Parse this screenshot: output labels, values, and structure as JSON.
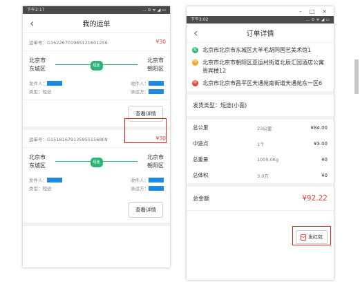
{
  "left": {
    "status_time": "下午2:17",
    "status_icons": "... ⊙ ᯤ ◢ ▭",
    "title": "我的运单",
    "cards": [
      {
        "waybill": "运单号：G15226701985121601256",
        "price": "¥30",
        "from_city": "北京市",
        "from_district": "东城区",
        "tag": "短途",
        "to_city": "北京市",
        "to_district": "朝阳区",
        "sender_label": "发件人：",
        "type_label": "类型：短途",
        "receiver_label": "收件人：",
        "carrier_label": "承运方：",
        "detail_button": "查看详情"
      },
      {
        "waybill": "运单号：G15181679135955156809",
        "price": "¥30",
        "from_city": "北京市",
        "from_district": "东城区",
        "tag": "短途",
        "to_city": "北京市",
        "to_district": "朝阳区",
        "sender_label": "发件人：",
        "type_label": "类型：短途",
        "receiver_label": "收件人：",
        "carrier_label": "承运方：",
        "detail_button": "查看详情"
      }
    ]
  },
  "right": {
    "window_controls": [
      "–",
      "□",
      "×"
    ],
    "status_time": "下午3:02",
    "status_icons": "... ⊙ ᯤ ◢ ▭",
    "title": "订单详情",
    "addresses": [
      {
        "marker": "起",
        "color": "#2bb673",
        "text": "北京市北京市东城区大羊毛胡同国艺美术馆1"
      },
      {
        "marker": "中",
        "color": "#f5a623",
        "text": "北京市北京市朝阳区亚运村街道北辰汇园酒店公寓贵宾楼12"
      },
      {
        "marker": "终",
        "color": "#e8403a",
        "text": "北京市北京市昌平区天通苑南街道天通苑东一区6"
      }
    ],
    "delivery_type": "发货类型：短途(小面)",
    "fees": [
      {
        "label": "总公里",
        "qty": "23公里",
        "amount": "¥84.00"
      },
      {
        "label": "中途点",
        "qty": "1个",
        "amount": "¥3.00"
      },
      {
        "label": "总重量",
        "qty": "1000.0Kg",
        "amount": "¥0"
      },
      {
        "label": "总体积",
        "qty": "3.0方",
        "amount": "¥0"
      }
    ],
    "total_label": "总金额",
    "total_amount": "¥92.22",
    "red_packet_button": "发红包"
  }
}
